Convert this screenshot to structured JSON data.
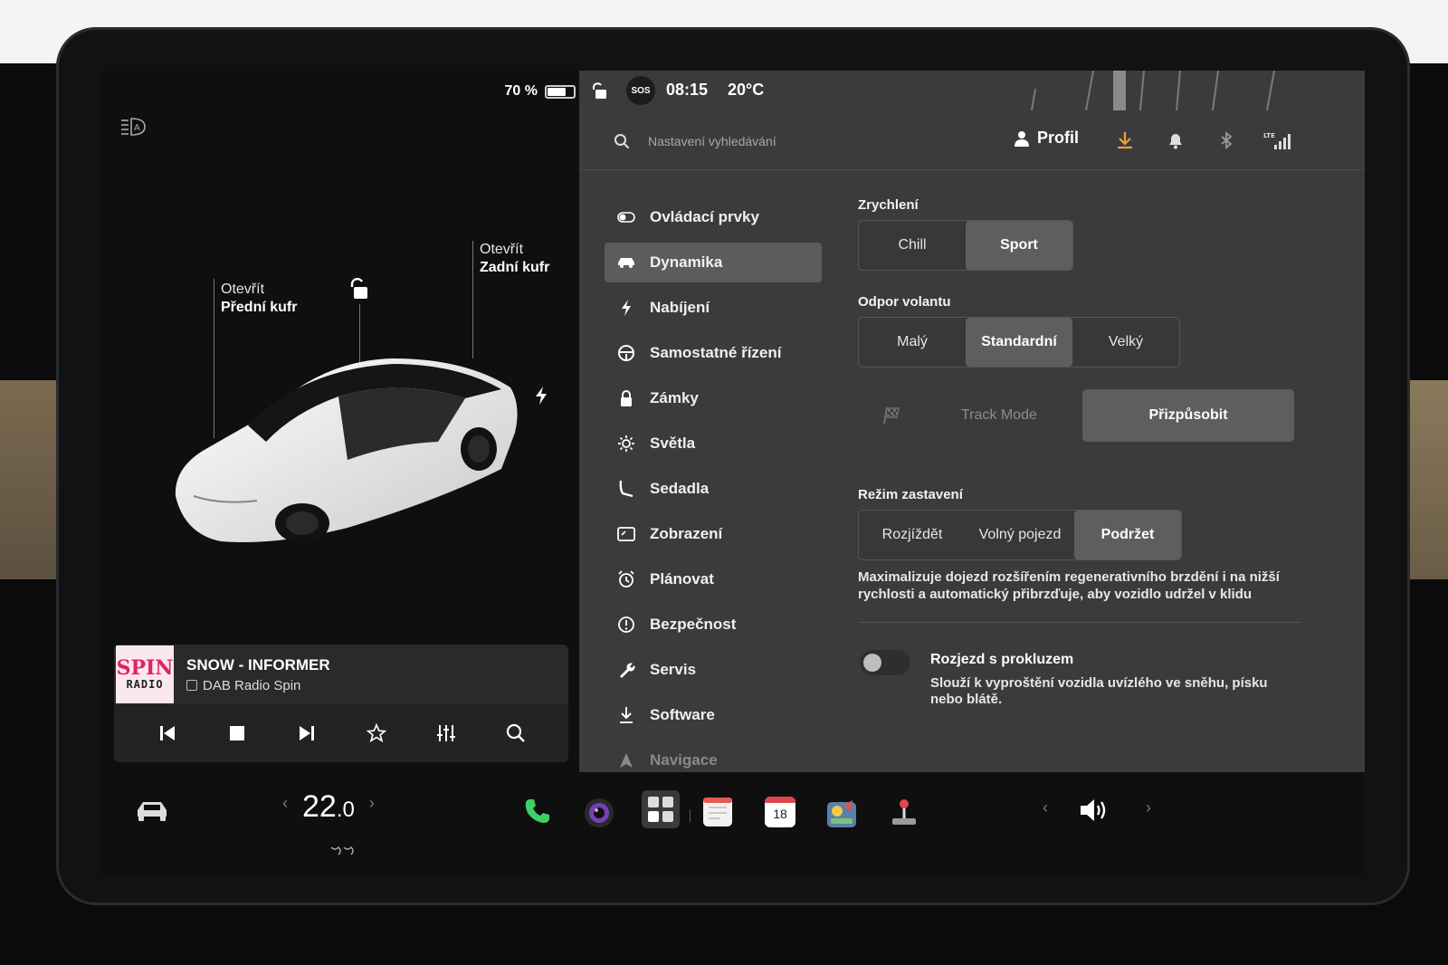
{
  "status": {
    "battery_percent": "70 %",
    "battery_level": 0.7,
    "time": "08:15",
    "temperature": "20°C",
    "sos_label": "SOS"
  },
  "car": {
    "frunk_action": "Otevřít",
    "frunk_label": "Přední kufr",
    "trunk_action": "Otevřít",
    "trunk_label": "Zadní kufr"
  },
  "media": {
    "album_line1": "SPIN",
    "album_line2": "RADIO",
    "title": "SNOW - INFORMER",
    "source": "DAB Radio Spin"
  },
  "topbar": {
    "search_placeholder": "Nastavení vyhledávání",
    "profile_label": "Profil",
    "signal_label": "LTE"
  },
  "menu": {
    "items": [
      {
        "label": "Ovládací prvky",
        "icon": "toggle-icon"
      },
      {
        "label": "Dynamika",
        "icon": "car-icon"
      },
      {
        "label": "Nabíjení",
        "icon": "bolt-icon"
      },
      {
        "label": "Samostatné řízení",
        "icon": "steering-wheel-icon"
      },
      {
        "label": "Zámky",
        "icon": "lock-icon"
      },
      {
        "label": "Světla",
        "icon": "sun-icon"
      },
      {
        "label": "Sedadla",
        "icon": "seat-icon"
      },
      {
        "label": "Zobrazení",
        "icon": "display-icon"
      },
      {
        "label": "Plánovat",
        "icon": "alarm-clock-icon"
      },
      {
        "label": "Bezpečnost",
        "icon": "alert-icon"
      },
      {
        "label": "Servis",
        "icon": "wrench-icon"
      },
      {
        "label": "Software",
        "icon": "download-icon"
      },
      {
        "label": "Navigace",
        "icon": "navigation-icon"
      }
    ],
    "active": "Dynamika"
  },
  "dynamics": {
    "acceleration": {
      "label": "Zrychlení",
      "options": [
        "Chill",
        "Sport"
      ],
      "selected": "Sport"
    },
    "steering": {
      "label": "Odpor volantu",
      "options": [
        "Malý",
        "Standardní",
        "Velký"
      ],
      "selected": "Standardní"
    },
    "track_mode_label": "Track Mode",
    "customize_label": "Přizpůsobit",
    "stopping": {
      "label": "Režim zastavení",
      "options": [
        "Rozjíždět",
        "Volný pojezd",
        "Podržet"
      ],
      "selected": "Podržet",
      "description": "Maximalizuje dojezd rozšířením regenerativního brzdění i na nižší rychlosti a automatický přibrzďuje, aby vozidlo udržel v klidu"
    },
    "slip_start": {
      "title": "Rozjezd s prokluzem",
      "description": "Slouží k vyproštění vozidla uvízlého ve sněhu, písku nebo blátě.",
      "enabled": false
    }
  },
  "dock": {
    "cabin_temp_main": "22",
    "cabin_temp_dec": ".0",
    "calendar_day": "18"
  },
  "colors": {
    "panel_bg": "#3b3b3d",
    "selected_bg": "#5e5e60",
    "charge_accent": "#e8a33c",
    "phone_green": "#3ecf6a"
  }
}
